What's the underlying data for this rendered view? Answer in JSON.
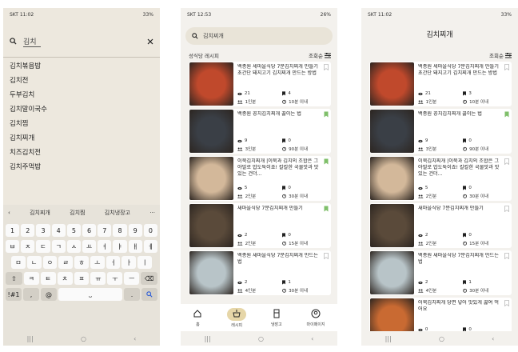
{
  "screen1": {
    "status": {
      "left": "SKT 11:02",
      "right": "33%"
    },
    "search": {
      "query": "김치"
    },
    "suggestions": [
      "김치볶음밥",
      "김치전",
      "두부김치",
      "김치말이국수",
      "김치찜",
      "김치찌개",
      "치즈김치전",
      "김치주먹밥"
    ],
    "keyboard": {
      "suggestions": [
        "김치찌개",
        "김치찜",
        "김치냉장고"
      ],
      "more": "···",
      "row_numbers": [
        "1",
        "2",
        "3",
        "4",
        "5",
        "6",
        "7",
        "8",
        "9",
        "0"
      ],
      "row1": [
        "ㅂ",
        "ㅈ",
        "ㄷ",
        "ㄱ",
        "ㅅ",
        "ㅛ",
        "ㅕ",
        "ㅑ",
        "ㅐ",
        "ㅔ"
      ],
      "row2": [
        "ㅁ",
        "ㄴ",
        "ㅇ",
        "ㄹ",
        "ㅎ",
        "ㅗ",
        "ㅓ",
        "ㅏ",
        "ㅣ"
      ],
      "row3": [
        "ㅋ",
        "ㅌ",
        "ㅊ",
        "ㅍ",
        "ㅠ",
        "ㅜ",
        "ㅡ"
      ],
      "sym": "!#1",
      "comma": ",",
      "dot": "."
    }
  },
  "screen2": {
    "status": {
      "left": "SKT 12:53",
      "right": "26%"
    },
    "search": {
      "text": "김치찌개"
    },
    "header": {
      "left": "성식당 레시피",
      "right": "조회순"
    },
    "tabs": [
      "홈",
      "레시피",
      "냉장고",
      "마이페이지"
    ],
    "cards": [
      {
        "title": "백종원 세마을식당 7분김치찌개 만들기 초간단 돼지고기 김치찌개 만드는 방법",
        "views": "21",
        "saves": "4",
        "serves": "1인분",
        "time": "10분 이내",
        "bookmarked": false,
        "thumb": "#c0492c"
      },
      {
        "title": "백종원 꽁치김치찌개 끓이는 법",
        "views": "9",
        "saves": "0",
        "serves": "3인분",
        "time": "90분 이내",
        "bookmarked": true,
        "thumb": "#3a3f46"
      },
      {
        "title": "이북김치찌개 |이북과 김치의 조합은 그야말로 밥도둑이죠! 칼칼한 국물맛과 맛있는 건더...",
        "views": "5",
        "saves": "0",
        "serves": "2인분",
        "time": "30분 이내",
        "bookmarked": true,
        "thumb": "#d3b89a"
      },
      {
        "title": "새마을식당 7분김치찌개 만들기",
        "views": "2",
        "saves": "0",
        "serves": "2인분",
        "time": "15분 이내",
        "bookmarked": true,
        "thumb": "#5a4a3a"
      },
      {
        "title": "백종원 새마을식당 7분김치찌개 만드는 법",
        "views": "2",
        "saves": "1",
        "serves": "4인분",
        "time": "30분 이내",
        "bookmarked": false,
        "thumb": "#b8c4c8"
      }
    ]
  },
  "screen3": {
    "status": {
      "left": "SKT 11:02",
      "right": "33%"
    },
    "title": "김치찌개",
    "header": {
      "right": "조회순"
    },
    "cards": [
      {
        "title": "백종원 세마을식당 7분김치찌개 만들기 초간단 돼지고기 김치찌개 만드는 방법",
        "views": "21",
        "saves": "3",
        "serves": "1인분",
        "time": "10분 이내",
        "bookmarked": false,
        "thumb": "#c0492c"
      },
      {
        "title": "백종원 꽁치김치찌개 끓이는 법",
        "views": "9",
        "saves": "0",
        "serves": "3인분",
        "time": "90분 이내",
        "bookmarked": true,
        "thumb": "#3a3f46"
      },
      {
        "title": "이북김치찌개 |이북과 김치의 조합은 그야말로 밥도둑이죠! 칼칼한 국물맛과 맛있는 건더...",
        "views": "5",
        "saves": "0",
        "serves": "2인분",
        "time": "30분 이내",
        "bookmarked": false,
        "thumb": "#d3b89a"
      },
      {
        "title": "새마을식당 7분김치찌개 만들기",
        "views": "2",
        "saves": "0",
        "serves": "2인분",
        "time": "15분 이내",
        "bookmarked": false,
        "thumb": "#5a4a3a"
      },
      {
        "title": "백종원 새마을식당 7분김치찌개 만드는 법",
        "views": "2",
        "saves": "1",
        "serves": "4인분",
        "time": "30분 이내",
        "bookmarked": false,
        "thumb": "#b8c4c8"
      },
      {
        "title": "어묵김치찌개 당면 넣어 맛있게 끓여 먹어요",
        "views": "0",
        "saves": "0",
        "serves": "",
        "time": "",
        "bookmarked": false,
        "thumb": "#c96a32"
      }
    ]
  },
  "colors": {
    "bookmark_on": "#7fbf6a",
    "bookmark_off": "#bbbbbb",
    "accent": "#e6d6a8"
  }
}
